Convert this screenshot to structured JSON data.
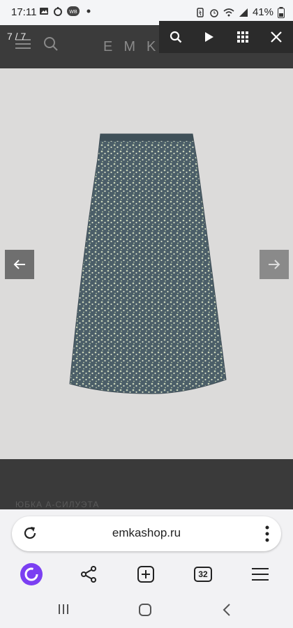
{
  "status_bar": {
    "time": "17:11",
    "left_icons": [
      "image-icon",
      "timer-icon",
      "wb-icon",
      "dot-icon"
    ],
    "battery": "41%",
    "right_icons": [
      "battery-saver-icon",
      "alarm-icon",
      "wifi-icon",
      "signal-icon",
      "battery-icon"
    ]
  },
  "site": {
    "logo": "EMKA",
    "product_caption": "ЮБКА А-СИЛУЭТА"
  },
  "lightbox": {
    "counter": "7 / 7",
    "toolbar": [
      "zoom-icon",
      "play-icon",
      "grid-icon",
      "close-icon"
    ],
    "image_alt": "skirt-image",
    "accent_dark": "#2b2b2b"
  },
  "browser": {
    "url": "emkashop.ru",
    "tab_count": "32",
    "accent": "#7b3ff2"
  },
  "android_nav": [
    "recent-apps",
    "home",
    "back"
  ]
}
